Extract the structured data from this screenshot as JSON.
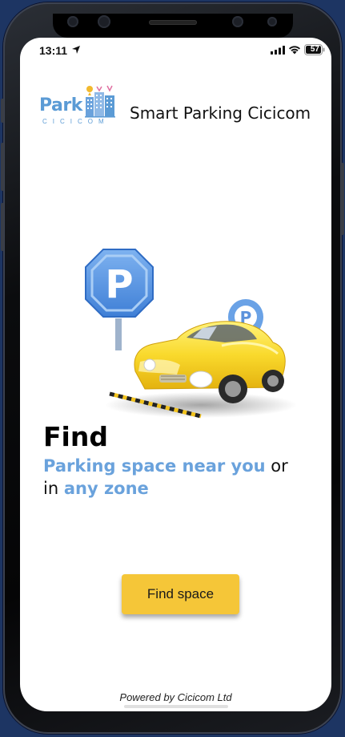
{
  "status_bar": {
    "time": "13:11",
    "battery": "57"
  },
  "header": {
    "logo_word": "Park",
    "logo_sub": "CICICOM",
    "title": "Smart Parking Cicicom"
  },
  "hero": {
    "headline": "Find",
    "line1_accent": "Parking space near you",
    "line1_rest": " or",
    "line2_prefix": "in ",
    "line2_accent": "any zone"
  },
  "actions": {
    "find_space_label": "Find space"
  },
  "footer": {
    "text": "Powered by Cicicom Ltd"
  },
  "colors": {
    "accent_blue": "#6aa2dc",
    "button_yellow": "#f5c638",
    "frame_background": "#1d3563"
  },
  "icons": {
    "location": "location-arrow-icon",
    "signal": "cellular-signal-icon",
    "wifi": "wifi-icon",
    "battery": "battery-icon"
  }
}
